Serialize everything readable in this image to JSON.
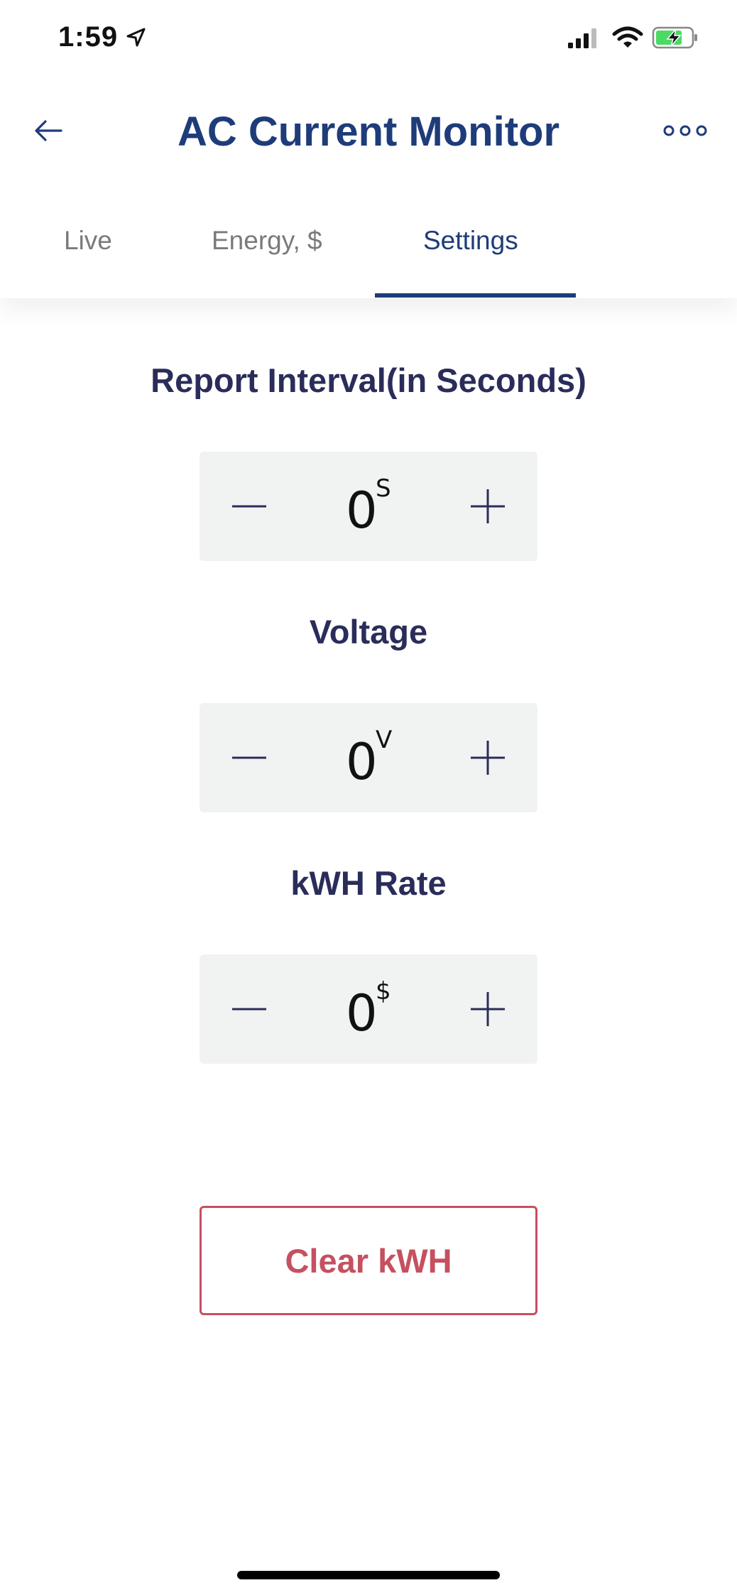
{
  "status": {
    "time": "1:59"
  },
  "header": {
    "title": "AC Current Monitor"
  },
  "tabs": [
    {
      "label": "Live"
    },
    {
      "label": "Energy, $"
    },
    {
      "label": "Settings",
      "active": true
    }
  ],
  "settings": {
    "report_interval": {
      "label": "Report Interval(in Seconds)",
      "value": "0",
      "unit": "S"
    },
    "voltage": {
      "label": "Voltage",
      "value": "0",
      "unit": "V"
    },
    "kwh_rate": {
      "label": "kWH Rate",
      "value": "0",
      "unit": "$"
    }
  },
  "actions": {
    "clear_label": "Clear kWH"
  },
  "colors": {
    "primary": "#1f3c7a",
    "heading": "#2a2d59",
    "danger": "#c45060",
    "stepper_bg": "#f1f2f2"
  },
  "icons": [
    "location-arrow-icon",
    "signal-icon",
    "wifi-icon",
    "battery-charging-icon",
    "back-arrow-icon",
    "more-icon",
    "minus-icon",
    "plus-icon"
  ]
}
